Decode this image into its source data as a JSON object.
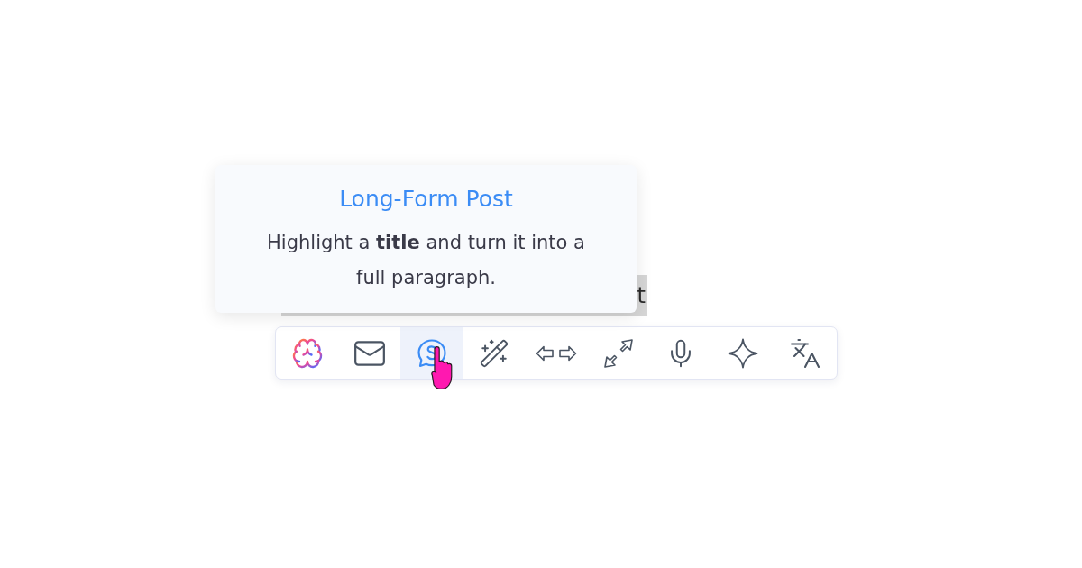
{
  "selection": {
    "visible_text": "t"
  },
  "tooltip": {
    "title": "Long-Form Post",
    "description": "Highlight a **title** and turn it into a full paragraph."
  },
  "toolbar": {
    "buttons": [
      {
        "kind": "brain",
        "selected": false
      },
      {
        "kind": "mail",
        "selected": false
      },
      {
        "kind": "bubble",
        "selected": true
      },
      {
        "kind": "wand",
        "selected": false
      },
      {
        "kind": "arrows",
        "selected": false
      },
      {
        "kind": "expand",
        "selected": false
      },
      {
        "kind": "mic",
        "selected": false
      },
      {
        "kind": "sparkle",
        "selected": false
      },
      {
        "kind": "translate",
        "selected": false
      }
    ]
  }
}
